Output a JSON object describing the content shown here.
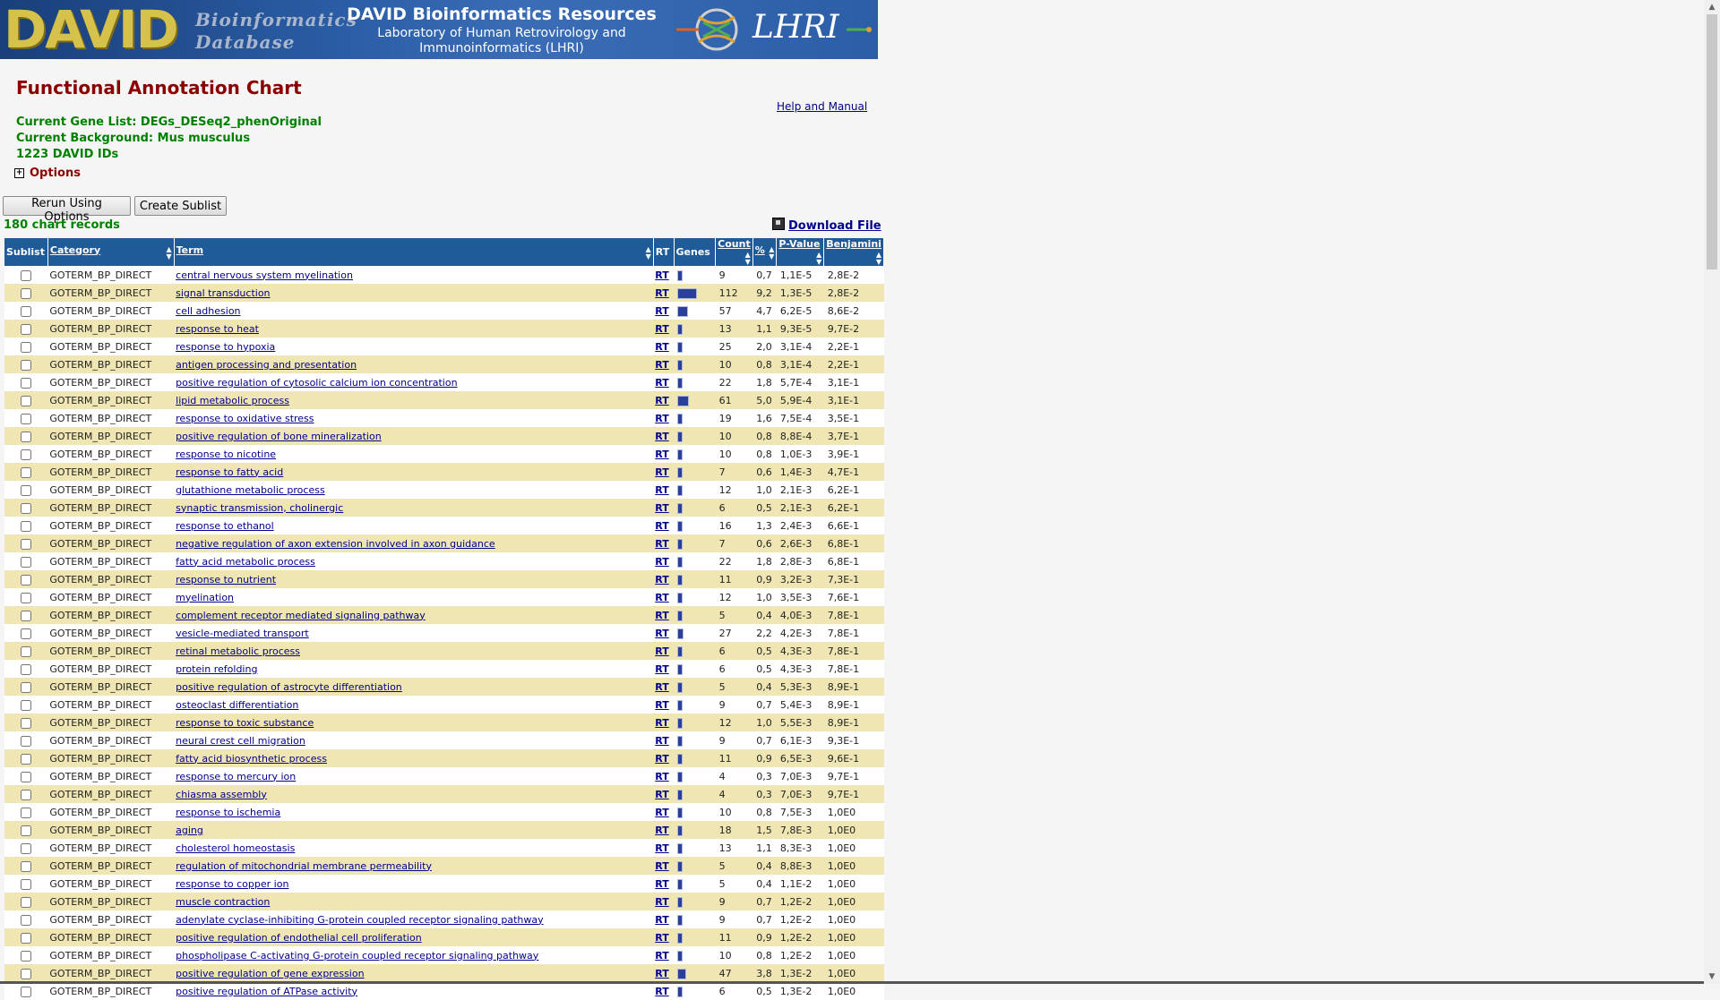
{
  "banner": {
    "logo_text": "DAVID",
    "logo_sub": "Bioinformatics Database",
    "title": "DAVID Bioinformatics Resources",
    "subtitle_line1": "Laboratory of Human Retrovirology and",
    "subtitle_line2": "Immunoinformatics (LHRI)",
    "lhri_text": "LHRI"
  },
  "page": {
    "title": "Functional Annotation Chart",
    "help_link": "Help and Manual",
    "gene_list": "Current Gene List: DEGs_DESeq2_phenOriginal",
    "background": "Current Background: Mus musculus",
    "david_ids": "1223 DAVID IDs",
    "options_label": "Options",
    "rerun_button": "Rerun Using Options",
    "sublist_button": "Create Sublist",
    "records": "180 chart records",
    "download": "Download File"
  },
  "table": {
    "headers": {
      "sublist": "Sublist",
      "category": "Category",
      "term": "Term",
      "rt": "RT",
      "genes": "Genes",
      "count": "Count",
      "percent": "%",
      "pvalue": "P-Value",
      "benjamini": "Benjamini"
    },
    "rows": [
      {
        "category": "GOTERM_BP_DIRECT",
        "term": "central nervous system myelination",
        "rt": "RT",
        "count": "9",
        "percent": "0,7",
        "pvalue": "1,1E-5",
        "benjamini": "2,8E-2"
      },
      {
        "category": "GOTERM_BP_DIRECT",
        "term": "signal transduction",
        "rt": "RT",
        "count": "112",
        "percent": "9,2",
        "pvalue": "1,3E-5",
        "benjamini": "2,8E-2"
      },
      {
        "category": "GOTERM_BP_DIRECT",
        "term": "cell adhesion",
        "rt": "RT",
        "count": "57",
        "percent": "4,7",
        "pvalue": "6,2E-5",
        "benjamini": "8,6E-2"
      },
      {
        "category": "GOTERM_BP_DIRECT",
        "term": "response to heat",
        "rt": "RT",
        "count": "13",
        "percent": "1,1",
        "pvalue": "9,3E-5",
        "benjamini": "9,7E-2"
      },
      {
        "category": "GOTERM_BP_DIRECT",
        "term": "response to hypoxia",
        "rt": "RT",
        "count": "25",
        "percent": "2,0",
        "pvalue": "3,1E-4",
        "benjamini": "2,2E-1"
      },
      {
        "category": "GOTERM_BP_DIRECT",
        "term": "antigen processing and presentation",
        "rt": "RT",
        "count": "10",
        "percent": "0,8",
        "pvalue": "3,1E-4",
        "benjamini": "2,2E-1"
      },
      {
        "category": "GOTERM_BP_DIRECT",
        "term": "positive regulation of cytosolic calcium ion concentration",
        "rt": "RT",
        "count": "22",
        "percent": "1,8",
        "pvalue": "5,7E-4",
        "benjamini": "3,1E-1"
      },
      {
        "category": "GOTERM_BP_DIRECT",
        "term": "lipid metabolic process",
        "rt": "RT",
        "count": "61",
        "percent": "5,0",
        "pvalue": "5,9E-4",
        "benjamini": "3,1E-1"
      },
      {
        "category": "GOTERM_BP_DIRECT",
        "term": "response to oxidative stress",
        "rt": "RT",
        "count": "19",
        "percent": "1,6",
        "pvalue": "7,5E-4",
        "benjamini": "3,5E-1"
      },
      {
        "category": "GOTERM_BP_DIRECT",
        "term": "positive regulation of bone mineralization",
        "rt": "RT",
        "count": "10",
        "percent": "0,8",
        "pvalue": "8,8E-4",
        "benjamini": "3,7E-1"
      },
      {
        "category": "GOTERM_BP_DIRECT",
        "term": "response to nicotine",
        "rt": "RT",
        "count": "10",
        "percent": "0,8",
        "pvalue": "1,0E-3",
        "benjamini": "3,9E-1"
      },
      {
        "category": "GOTERM_BP_DIRECT",
        "term": "response to fatty acid",
        "rt": "RT",
        "count": "7",
        "percent": "0,6",
        "pvalue": "1,4E-3",
        "benjamini": "4,7E-1"
      },
      {
        "category": "GOTERM_BP_DIRECT",
        "term": "glutathione metabolic process",
        "rt": "RT",
        "count": "12",
        "percent": "1,0",
        "pvalue": "2,1E-3",
        "benjamini": "6,2E-1"
      },
      {
        "category": "GOTERM_BP_DIRECT",
        "term": "synaptic transmission, cholinergic",
        "rt": "RT",
        "count": "6",
        "percent": "0,5",
        "pvalue": "2,1E-3",
        "benjamini": "6,2E-1"
      },
      {
        "category": "GOTERM_BP_DIRECT",
        "term": "response to ethanol",
        "rt": "RT",
        "count": "16",
        "percent": "1,3",
        "pvalue": "2,4E-3",
        "benjamini": "6,6E-1"
      },
      {
        "category": "GOTERM_BP_DIRECT",
        "term": "negative regulation of axon extension involved in axon guidance",
        "rt": "RT",
        "count": "7",
        "percent": "0,6",
        "pvalue": "2,6E-3",
        "benjamini": "6,8E-1"
      },
      {
        "category": "GOTERM_BP_DIRECT",
        "term": "fatty acid metabolic process",
        "rt": "RT",
        "count": "22",
        "percent": "1,8",
        "pvalue": "2,8E-3",
        "benjamini": "6,8E-1"
      },
      {
        "category": "GOTERM_BP_DIRECT",
        "term": "response to nutrient",
        "rt": "RT",
        "count": "11",
        "percent": "0,9",
        "pvalue": "3,2E-3",
        "benjamini": "7,3E-1"
      },
      {
        "category": "GOTERM_BP_DIRECT",
        "term": "myelination",
        "rt": "RT",
        "count": "12",
        "percent": "1,0",
        "pvalue": "3,5E-3",
        "benjamini": "7,6E-1"
      },
      {
        "category": "GOTERM_BP_DIRECT",
        "term": "complement receptor mediated signaling pathway",
        "rt": "RT",
        "count": "5",
        "percent": "0,4",
        "pvalue": "4,0E-3",
        "benjamini": "7,8E-1"
      },
      {
        "category": "GOTERM_BP_DIRECT",
        "term": "vesicle-mediated transport",
        "rt": "RT",
        "count": "27",
        "percent": "2,2",
        "pvalue": "4,2E-3",
        "benjamini": "7,8E-1"
      },
      {
        "category": "GOTERM_BP_DIRECT",
        "term": "retinal metabolic process",
        "rt": "RT",
        "count": "6",
        "percent": "0,5",
        "pvalue": "4,3E-3",
        "benjamini": "7,8E-1"
      },
      {
        "category": "GOTERM_BP_DIRECT",
        "term": "protein refolding",
        "rt": "RT",
        "count": "6",
        "percent": "0,5",
        "pvalue": "4,3E-3",
        "benjamini": "7,8E-1"
      },
      {
        "category": "GOTERM_BP_DIRECT",
        "term": "positive regulation of astrocyte differentiation",
        "rt": "RT",
        "count": "5",
        "percent": "0,4",
        "pvalue": "5,3E-3",
        "benjamini": "8,9E-1"
      },
      {
        "category": "GOTERM_BP_DIRECT",
        "term": "osteoclast differentiation",
        "rt": "RT",
        "count": "9",
        "percent": "0,7",
        "pvalue": "5,4E-3",
        "benjamini": "8,9E-1"
      },
      {
        "category": "GOTERM_BP_DIRECT",
        "term": "response to toxic substance",
        "rt": "RT",
        "count": "12",
        "percent": "1,0",
        "pvalue": "5,5E-3",
        "benjamini": "8,9E-1"
      },
      {
        "category": "GOTERM_BP_DIRECT",
        "term": "neural crest cell migration",
        "rt": "RT",
        "count": "9",
        "percent": "0,7",
        "pvalue": "6,1E-3",
        "benjamini": "9,3E-1"
      },
      {
        "category": "GOTERM_BP_DIRECT",
        "term": "fatty acid biosynthetic process",
        "rt": "RT",
        "count": "11",
        "percent": "0,9",
        "pvalue": "6,5E-3",
        "benjamini": "9,6E-1"
      },
      {
        "category": "GOTERM_BP_DIRECT",
        "term": "response to mercury ion",
        "rt": "RT",
        "count": "4",
        "percent": "0,3",
        "pvalue": "7,0E-3",
        "benjamini": "9,7E-1"
      },
      {
        "category": "GOTERM_BP_DIRECT",
        "term": "chiasma assembly",
        "rt": "RT",
        "count": "4",
        "percent": "0,3",
        "pvalue": "7,0E-3",
        "benjamini": "9,7E-1"
      },
      {
        "category": "GOTERM_BP_DIRECT",
        "term": "response to ischemia",
        "rt": "RT",
        "count": "10",
        "percent": "0,8",
        "pvalue": "7,5E-3",
        "benjamini": "1,0E0"
      },
      {
        "category": "GOTERM_BP_DIRECT",
        "term": "aging",
        "rt": "RT",
        "count": "18",
        "percent": "1,5",
        "pvalue": "7,8E-3",
        "benjamini": "1,0E0"
      },
      {
        "category": "GOTERM_BP_DIRECT",
        "term": "cholesterol homeostasis",
        "rt": "RT",
        "count": "13",
        "percent": "1,1",
        "pvalue": "8,3E-3",
        "benjamini": "1,0E0"
      },
      {
        "category": "GOTERM_BP_DIRECT",
        "term": "regulation of mitochondrial membrane permeability",
        "rt": "RT",
        "count": "5",
        "percent": "0,4",
        "pvalue": "8,8E-3",
        "benjamini": "1,0E0"
      },
      {
        "category": "GOTERM_BP_DIRECT",
        "term": "response to copper ion",
        "rt": "RT",
        "count": "5",
        "percent": "0,4",
        "pvalue": "1,1E-2",
        "benjamini": "1,0E0"
      },
      {
        "category": "GOTERM_BP_DIRECT",
        "term": "muscle contraction",
        "rt": "RT",
        "count": "9",
        "percent": "0,7",
        "pvalue": "1,2E-2",
        "benjamini": "1,0E0"
      },
      {
        "category": "GOTERM_BP_DIRECT",
        "term": "adenylate cyclase-inhibiting G-protein coupled receptor signaling pathway",
        "rt": "RT",
        "count": "9",
        "percent": "0,7",
        "pvalue": "1,2E-2",
        "benjamini": "1,0E0"
      },
      {
        "category": "GOTERM_BP_DIRECT",
        "term": "positive regulation of endothelial cell proliferation",
        "rt": "RT",
        "count": "11",
        "percent": "0,9",
        "pvalue": "1,2E-2",
        "benjamini": "1,0E0"
      },
      {
        "category": "GOTERM_BP_DIRECT",
        "term": "phospholipase C-activating G-protein coupled receptor signaling pathway",
        "rt": "RT",
        "count": "10",
        "percent": "0,8",
        "pvalue": "1,2E-2",
        "benjamini": "1,0E0"
      },
      {
        "category": "GOTERM_BP_DIRECT",
        "term": "positive regulation of gene expression",
        "rt": "RT",
        "count": "47",
        "percent": "3,8",
        "pvalue": "1,3E-2",
        "benjamini": "1,0E0"
      },
      {
        "category": "GOTERM_BP_DIRECT",
        "term": "positive regulation of ATPase activity",
        "rt": "RT",
        "count": "6",
        "percent": "0,5",
        "pvalue": "1,3E-2",
        "benjamini": "1,0E0"
      }
    ]
  },
  "colors": {
    "header_bg": "#1f5a99",
    "row_alt": "#efe6b4",
    "title": "#8b0000",
    "info": "#008000",
    "link": "#00008b"
  }
}
